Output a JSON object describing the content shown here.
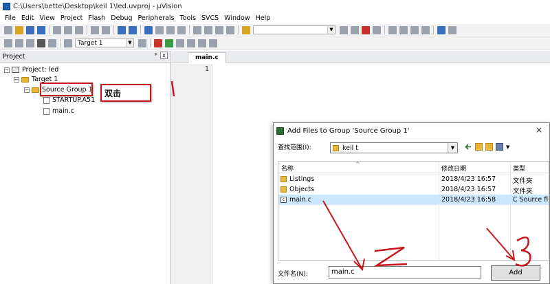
{
  "window": {
    "title": "C:\\Users\\bette\\Desktop\\keil 1\\led.uvproj - µVision"
  },
  "menu": [
    "File",
    "Edit",
    "View",
    "Project",
    "Flash",
    "Debug",
    "Peripherals",
    "Tools",
    "SVCS",
    "Window",
    "Help"
  ],
  "toolbar": {
    "target": "Target 1"
  },
  "project_panel": {
    "header": "Project",
    "pin": "ᵖ",
    "close": "x",
    "tree": {
      "project": "Project: led",
      "target": "Target 1",
      "group": "Source Group 1",
      "files": [
        "STARTUP.A51",
        "main.c"
      ]
    },
    "annotation": "双击"
  },
  "editor": {
    "tab": "main.c",
    "line_numbers": [
      "1"
    ]
  },
  "dialog": {
    "title": "Add Files to Group 'Source Group 1'",
    "close": "×",
    "look_in_label": "查找范围(I):",
    "look_in_value": "keil t",
    "columns": [
      "名称",
      "修改日期",
      "类型"
    ],
    "files": [
      {
        "name": "Listings",
        "date": "2018/4/23 16:57",
        "type": "文件夹",
        "kind": "folder",
        "selected": false
      },
      {
        "name": "Objects",
        "date": "2018/4/23 16:57",
        "type": "文件夹",
        "kind": "folder",
        "selected": false
      },
      {
        "name": "main.c",
        "date": "2018/4/23 16:58",
        "type": "C Source fi",
        "kind": "c",
        "selected": true
      }
    ],
    "filename_label": "文件名(N):",
    "filename_value": "main.c",
    "add_button": "Add"
  },
  "colors": {
    "annotation_red": "#c8161d",
    "selection": "#cce8ff",
    "folder": "#e8b73a"
  },
  "annotations": {
    "numbers": [
      "1",
      "2",
      "3"
    ]
  }
}
